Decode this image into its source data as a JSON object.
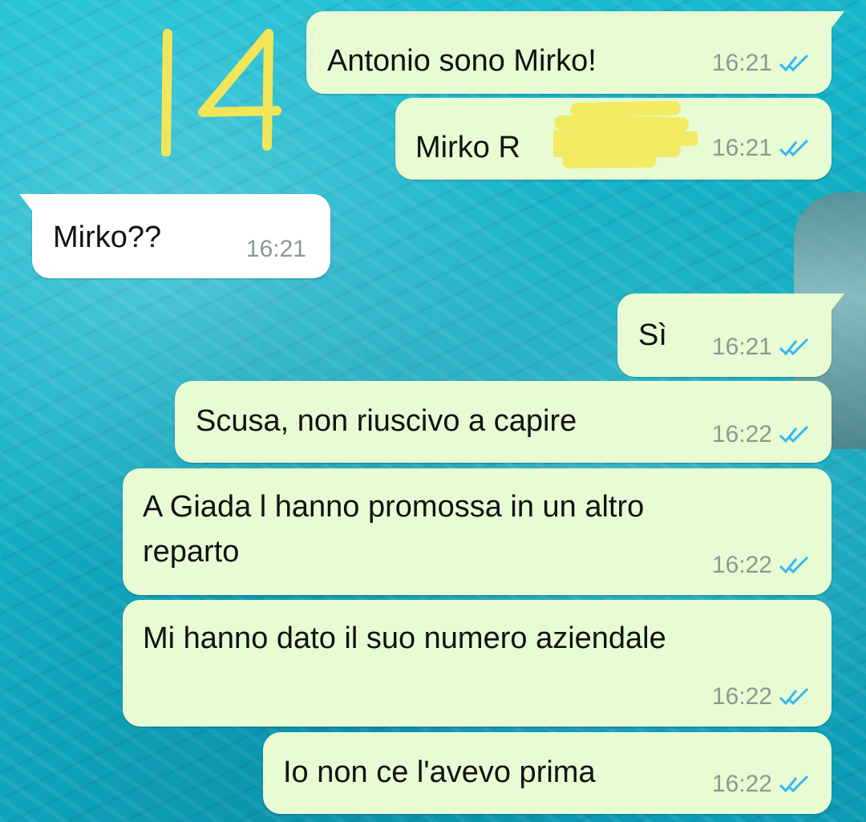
{
  "annotation": {
    "text": "14"
  },
  "messages": [
    {
      "id": "m1",
      "direction": "outgoing",
      "text": "Antonio sono Mirko!",
      "time": "16:21",
      "status": "read"
    },
    {
      "id": "m2",
      "direction": "outgoing",
      "text": "Mirko R",
      "time": "16:21",
      "status": "read",
      "redacted": true
    },
    {
      "id": "m3",
      "direction": "incoming",
      "text": "Mirko??",
      "time": "16:21"
    },
    {
      "id": "m4",
      "direction": "outgoing",
      "text": "Sì",
      "time": "16:21",
      "status": "read"
    },
    {
      "id": "m5",
      "direction": "outgoing",
      "text": "Scusa, non riuscivo a capire",
      "time": "16:22",
      "status": "read"
    },
    {
      "id": "m6",
      "direction": "outgoing",
      "text_lines": [
        "A Giada l hanno promossa in un altro",
        "reparto"
      ],
      "time": "16:22",
      "status": "read"
    },
    {
      "id": "m7",
      "direction": "outgoing",
      "text": "Mi hanno dato il suo numero aziendale",
      "time": "16:22",
      "status": "read"
    },
    {
      "id": "m8",
      "direction": "outgoing",
      "text": "Io non ce l'avevo prima",
      "time": "16:22",
      "status": "read"
    }
  ],
  "colors": {
    "outgoing_bubble": "#e7fcd3",
    "incoming_bubble": "#ffffff",
    "read_ticks": "#34b7f1",
    "timestamp": "#8a9a8f",
    "annotation": "#f1e65a",
    "redaction": "#f3ea63"
  },
  "icons": {
    "read_status": "double-check-icon"
  }
}
